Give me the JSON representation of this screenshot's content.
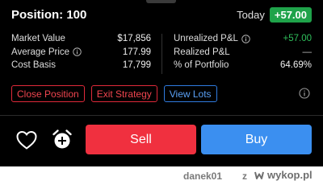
{
  "header": {
    "position_label": "Position: 100",
    "today_label": "Today",
    "today_change": "+57.00"
  },
  "stats_left": [
    {
      "label": "Market Value",
      "value": "$17,856",
      "info": false
    },
    {
      "label": "Average Price",
      "value": "177.99",
      "info": true
    },
    {
      "label": "Cost Basis",
      "value": "17,799",
      "info": false
    }
  ],
  "stats_right": [
    {
      "label": "Unrealized P&L",
      "value": "+57.00",
      "info": true
    },
    {
      "label": "Realized P&L",
      "value": "—",
      "info": false
    },
    {
      "label": "% of Portfolio",
      "value": "64.69%",
      "info": false
    }
  ],
  "actions": {
    "close_position": "Close Position",
    "exit_strategy": "Exit Strategy",
    "view_lots": "View Lots"
  },
  "trade": {
    "sell_label": "Sell",
    "buy_label": "Buy"
  },
  "footer": {
    "username": "danek01",
    "separator": "z",
    "brand": "wykop.pl"
  },
  "icons": {
    "info": "info-icon",
    "favorite": "heart-outline-icon",
    "alert": "alarm-clock-add-icon",
    "brand": "wykop-logo-icon"
  },
  "colors": {
    "background": "#000000",
    "positive": "#1fa34a",
    "sell": "#f0303f",
    "buy": "#3b8ff0",
    "outline_red": "#e0293a",
    "outline_blue": "#2f7be0"
  }
}
